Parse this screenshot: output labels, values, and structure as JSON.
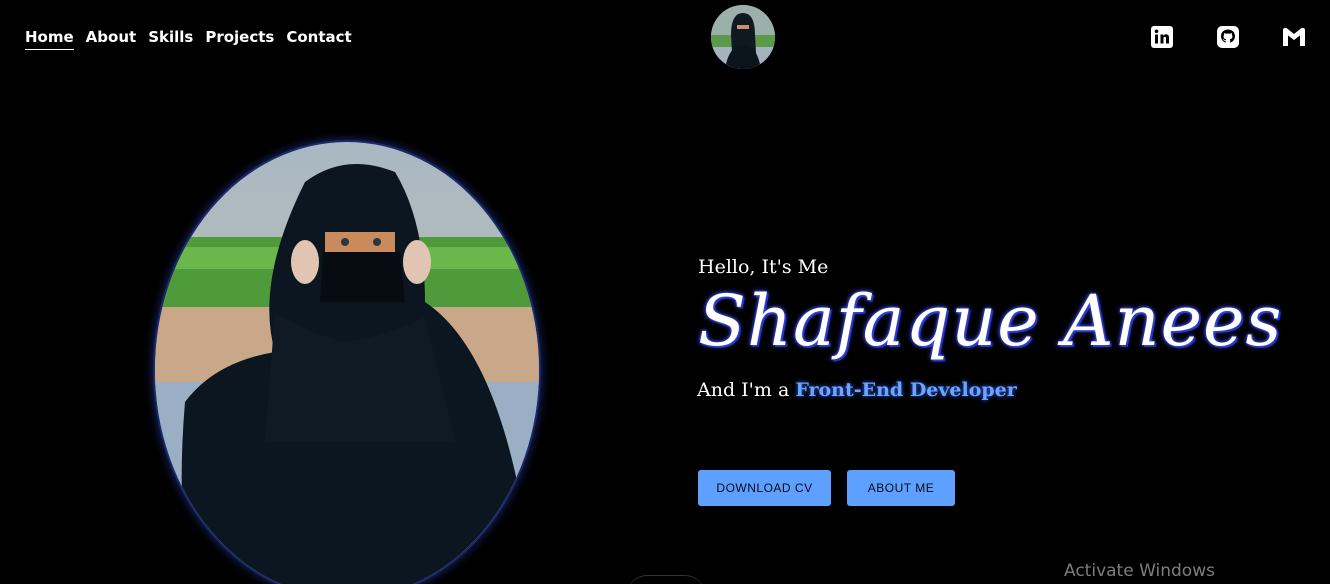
{
  "nav": {
    "items": [
      {
        "label": "Home",
        "active": true
      },
      {
        "label": "About"
      },
      {
        "label": "Skills"
      },
      {
        "label": "Projects"
      },
      {
        "label": "Contact"
      }
    ]
  },
  "header": {
    "avatar_icon": "profile-avatar"
  },
  "socials": [
    {
      "icon": "linkedin-icon"
    },
    {
      "icon": "github-icon"
    },
    {
      "icon": "gmail-icon"
    }
  ],
  "hero": {
    "greeting": "Hello, It's Me",
    "name": "Shafaque Anees",
    "role_prefix": "And I'm a ",
    "role_highlight": "Front-End Developer",
    "buttons": {
      "download_cv": "DOWNLOAD CV",
      "about_me": "ABOUT ME"
    }
  },
  "system": {
    "watermark": "Activate Windows"
  },
  "colors": {
    "background": "#000000",
    "accent": "#5da0ff",
    "highlight": "#6fa3ff",
    "glow": "#3040e0"
  }
}
